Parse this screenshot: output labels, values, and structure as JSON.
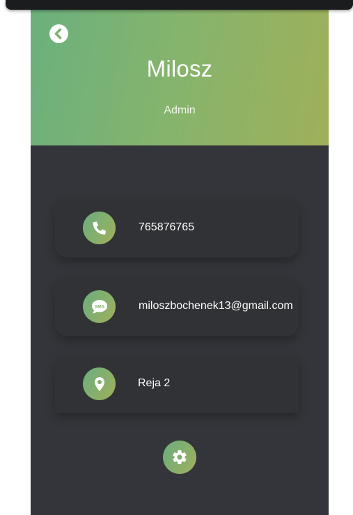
{
  "profile": {
    "name": "Milosz",
    "role": "Admin"
  },
  "contacts": {
    "phone": {
      "value": "765876765",
      "icon": "phone-icon"
    },
    "email": {
      "value": "miloszbochenek13@gmail.com",
      "icon": "sms-icon",
      "icon_text": "SMS"
    },
    "address": {
      "value": "Reja 2",
      "icon": "location-pin-icon"
    }
  },
  "actions": {
    "back_icon": "chevron-left-icon",
    "settings_icon": "gear-icon"
  },
  "colors": {
    "header_gradient_start": "#6bb07e",
    "header_gradient_end": "#9fb05a",
    "body_background": "#33353a",
    "card_background": "#303236"
  }
}
